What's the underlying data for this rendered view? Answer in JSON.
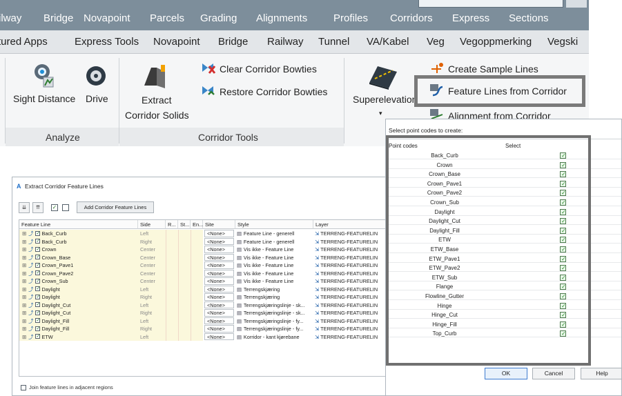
{
  "ribbon": {
    "top_tabs": [
      "ilway",
      "Bridge",
      "Novapoint",
      "Parcels",
      "Grading",
      "Alignments",
      "Profiles",
      "Corridors",
      "Express",
      "Sections"
    ],
    "sub_tabs": [
      "tured Apps",
      "Express Tools",
      "Novapoint",
      "Bridge",
      "Railway",
      "Tunnel",
      "VA/Kabel",
      "Veg",
      "Vegoppmerking",
      "Vegski"
    ],
    "analyze": {
      "sight_distance": "Sight Distance",
      "drive": "Drive",
      "panel_title": "Analyze"
    },
    "corridor_tools": {
      "extract_line1": "Extract",
      "extract_line2": "Corridor Solids",
      "clear_bowties": "Clear Corridor Bowties",
      "restore_bowties": "Restore Corridor Bowties",
      "panel_title": "Corridor Tools"
    },
    "superelevation": "Superelevation",
    "create_sample_lines": "Create Sample Lines",
    "feature_lines_from_corridor": "Feature Lines from Corridor",
    "alignment_from_corridor": "Alignment from Corridor"
  },
  "extract_dialog": {
    "title": "Extract Corridor Feature Lines",
    "add_button": "Add Corridor Feature Lines",
    "columns": [
      "Feature Line",
      "Side",
      "R...",
      "St...",
      "En...",
      "Site",
      "Style",
      "Layer"
    ],
    "rows": [
      {
        "name": "Back_Curb",
        "side": "Left",
        "site": "<None>",
        "style": "Feature Line - generell",
        "layer": "TERRENG-FEATURELIN"
      },
      {
        "name": "Back_Curb",
        "side": "Right",
        "site": "<None>",
        "style": "Feature Line - generell",
        "layer": "TERRENG-FEATURELIN"
      },
      {
        "name": "Crown",
        "side": "Center",
        "site": "<None>",
        "style": "Vis ikke - Feature Line",
        "layer": "TERRENG-FEATURELIN"
      },
      {
        "name": "Crown_Base",
        "side": "Center",
        "site": "<None>",
        "style": "Vis ikke - Feature Line",
        "layer": "TERRENG-FEATURELIN"
      },
      {
        "name": "Crown_Pave1",
        "side": "Center",
        "site": "<None>",
        "style": "Vis ikke - Feature Line",
        "layer": "TERRENG-FEATURELIN"
      },
      {
        "name": "Crown_Pave2",
        "side": "Center",
        "site": "<None>",
        "style": "Vis ikke - Feature Line",
        "layer": "TERRENG-FEATURELIN"
      },
      {
        "name": "Crown_Sub",
        "side": "Center",
        "site": "<None>",
        "style": "Vis ikke - Feature Line",
        "layer": "TERRENG-FEATURELIN"
      },
      {
        "name": "Daylight",
        "side": "Left",
        "site": "<None>",
        "style": "Terrengskjæring",
        "layer": "TERRENG-FEATURELIN"
      },
      {
        "name": "Daylight",
        "side": "Right",
        "site": "<None>",
        "style": "Terrengskjæring",
        "layer": "TERRENG-FEATURELIN"
      },
      {
        "name": "Daylight_Cut",
        "side": "Left",
        "site": "<None>",
        "style": "Terrengskjæringslinje - sk...",
        "layer": "TERRENG-FEATURELIN"
      },
      {
        "name": "Daylight_Cut",
        "side": "Right",
        "site": "<None>",
        "style": "Terrengskjæringslinje - sk...",
        "layer": "TERRENG-FEATURELIN"
      },
      {
        "name": "Daylight_Fill",
        "side": "Left",
        "site": "<None>",
        "style": "Terrengskjæringslinje - fy...",
        "layer": "TERRENG-FEATURELIN"
      },
      {
        "name": "Daylight_Fill",
        "side": "Right",
        "site": "<None>",
        "style": "Terrengskjæringslinje - fy...",
        "layer": "TERRENG-FEATURELIN"
      },
      {
        "name": "ETW",
        "side": "Left",
        "site": "<None>",
        "style": "Korridor - kant kjørebane",
        "layer": "TERRENG-FEATURELIN"
      }
    ],
    "join_option": "Join feature lines in adjacent regions"
  },
  "codes_dialog": {
    "title": "Select point codes to create:",
    "col_codes": "Point codes",
    "col_select": "Select",
    "codes": [
      "Back_Curb",
      "Crown",
      "Crown_Base",
      "Crown_Pave1",
      "Crown_Pave2",
      "Crown_Sub",
      "Daylight",
      "Daylight_Cut",
      "Daylight_Fill",
      "ETW",
      "ETW_Base",
      "ETW_Pave1",
      "ETW_Pave2",
      "ETW_Sub",
      "Flange",
      "Flowline_Gutter",
      "Hinge",
      "Hinge_Cut",
      "Hinge_Fill",
      "Top_Curb"
    ],
    "ok": "OK",
    "cancel": "Cancel",
    "help": "Help"
  }
}
